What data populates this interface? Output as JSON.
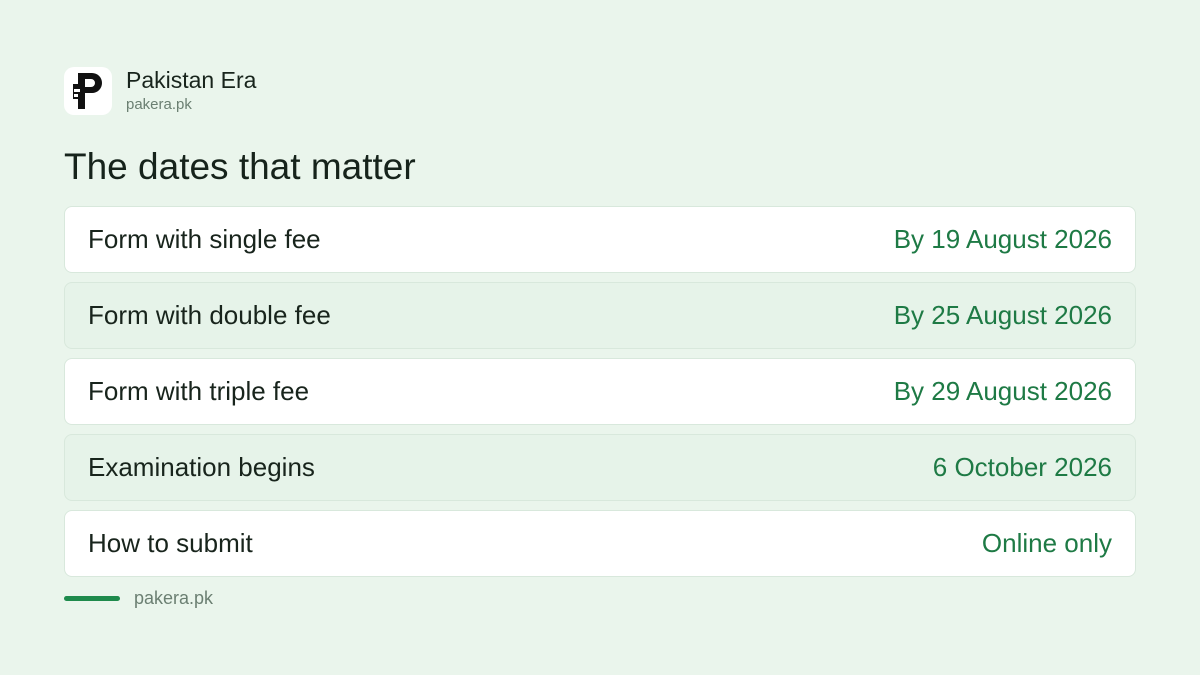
{
  "brand": {
    "name": "Pakistan Era",
    "url": "pakera.pk",
    "logo_icon": "pakera-logo-icon"
  },
  "heading": "The dates that matter",
  "rows": [
    {
      "label": "Form with single fee",
      "value": "By 19 August 2026"
    },
    {
      "label": "Form with double fee",
      "value": "By 25 August 2026"
    },
    {
      "label": "Form with triple fee",
      "value": "By 29 August 2026"
    },
    {
      "label": "Examination begins",
      "value": "6 October 2026"
    },
    {
      "label": "How to submit",
      "value": "Online only"
    }
  ],
  "footer": {
    "text": "pakera.pk"
  },
  "colors": {
    "background": "#eaf5ec",
    "accent": "#1e7a45",
    "text": "#18241c",
    "muted": "#6b7f72"
  }
}
